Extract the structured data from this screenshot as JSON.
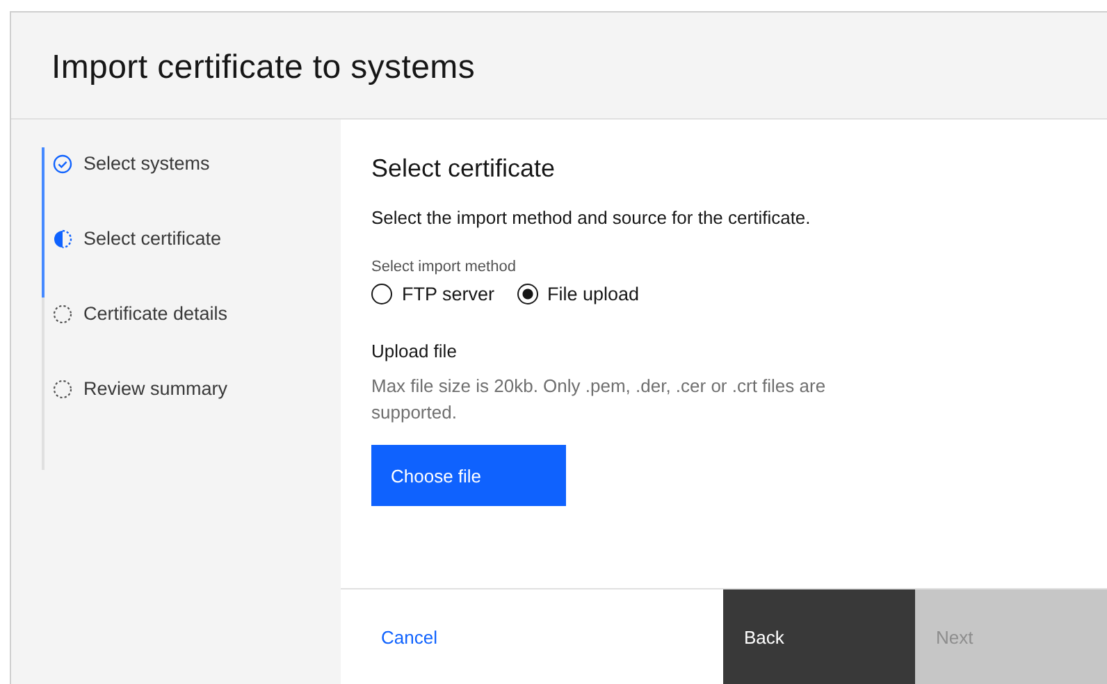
{
  "window": {
    "title": "Import certificate to systems"
  },
  "steps": [
    {
      "label": "Select systems",
      "kind": "complete"
    },
    {
      "label": "Select certificate",
      "kind": "current"
    },
    {
      "label": "Certificate details",
      "kind": "incomplete"
    },
    {
      "label": "Review summary",
      "kind": "incomplete"
    }
  ],
  "content": {
    "heading": "Select certificate",
    "description": "Select the import method and source for the certificate.",
    "method_label": "Select import method",
    "methods": [
      {
        "label": "FTP server",
        "selected": false
      },
      {
        "label": "File upload",
        "selected": true
      }
    ],
    "upload_title": "Upload file",
    "upload_help": "Max file size is 20kb. Only .pem, .der, .cer or .crt files are supported.",
    "choose_button": "Choose file"
  },
  "footer": {
    "cancel": "Cancel",
    "back": {
      "label": "Back",
      "disabled": false
    },
    "next": {
      "label": "Next",
      "disabled": true
    }
  }
}
